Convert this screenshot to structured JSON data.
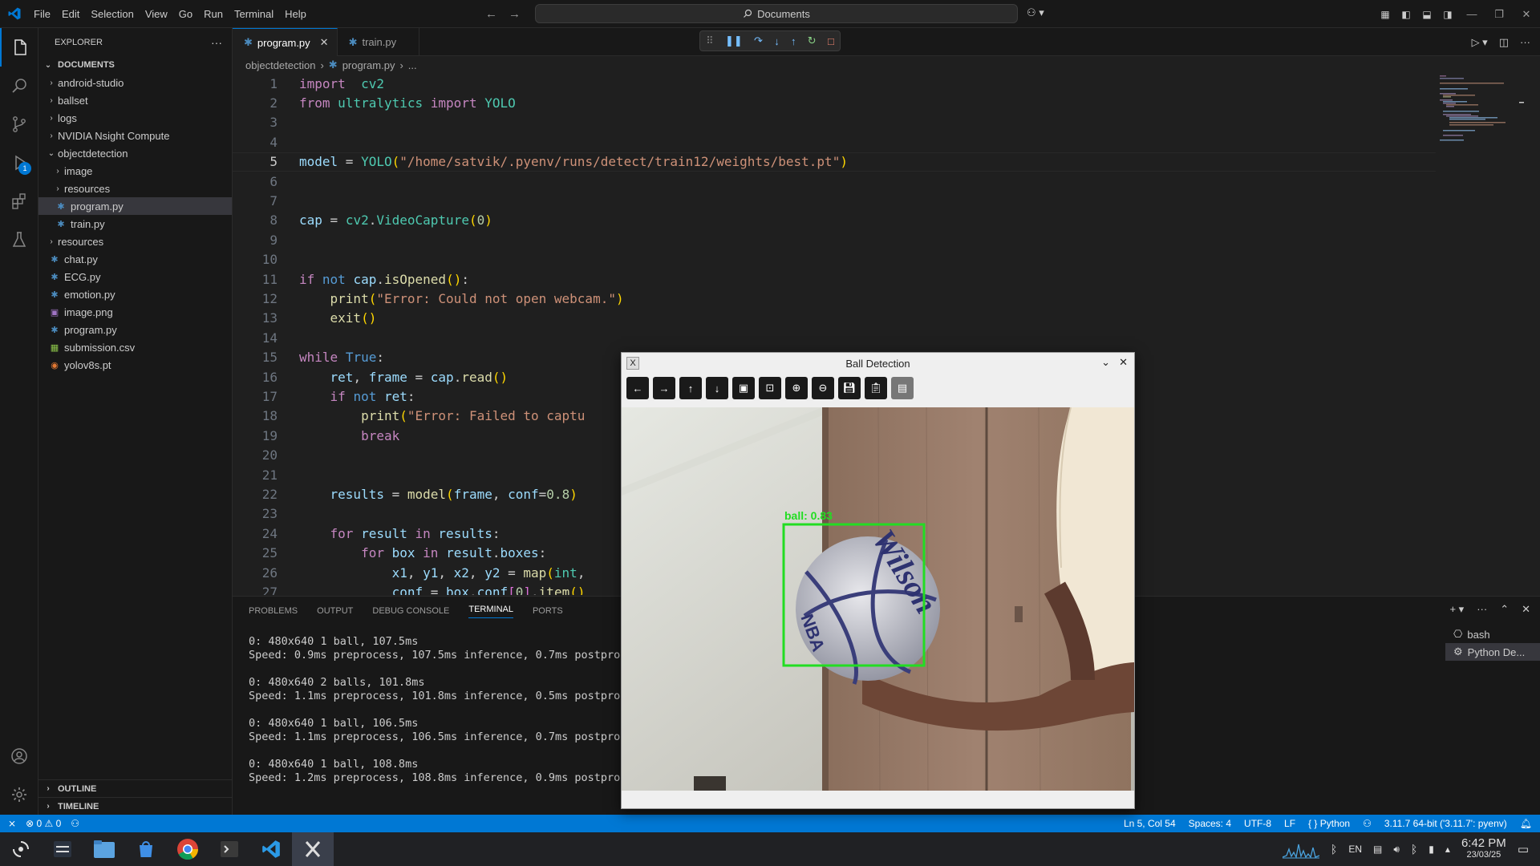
{
  "window": {
    "menu": [
      "File",
      "Edit",
      "Selection",
      "View",
      "Go",
      "Run",
      "Terminal",
      "Help"
    ],
    "search_text": "Documents"
  },
  "sidebar": {
    "header": "EXPLORER",
    "section": "DOCUMENTS",
    "items": [
      {
        "label": "android-studio",
        "type": "folder",
        "depth": 0,
        "open": false
      },
      {
        "label": "ballset",
        "type": "folder",
        "depth": 0,
        "open": false
      },
      {
        "label": "logs",
        "type": "folder",
        "depth": 0,
        "open": false
      },
      {
        "label": "NVIDIA Nsight Compute",
        "type": "folder",
        "depth": 0,
        "open": false
      },
      {
        "label": "objectdetection",
        "type": "folder",
        "depth": 0,
        "open": true
      },
      {
        "label": "image",
        "type": "folder",
        "depth": 1,
        "open": false
      },
      {
        "label": "resources",
        "type": "folder",
        "depth": 1,
        "open": false
      },
      {
        "label": "program.py",
        "type": "py",
        "depth": 1,
        "selected": true
      },
      {
        "label": "train.py",
        "type": "py",
        "depth": 1
      },
      {
        "label": "resources",
        "type": "folder",
        "depth": 0,
        "open": false
      },
      {
        "label": "chat.py",
        "type": "py",
        "depth": 0
      },
      {
        "label": "ECG.py",
        "type": "py",
        "depth": 0
      },
      {
        "label": "emotion.py",
        "type": "py",
        "depth": 0
      },
      {
        "label": "image.png",
        "type": "png",
        "depth": 0
      },
      {
        "label": "program.py",
        "type": "py",
        "depth": 0
      },
      {
        "label": "submission.csv",
        "type": "csv",
        "depth": 0
      },
      {
        "label": "yolov8s.pt",
        "type": "pt",
        "depth": 0
      }
    ],
    "outline": "OUTLINE",
    "timeline": "TIMELINE",
    "debug_badge": "1"
  },
  "tabs": [
    {
      "label": "program.py",
      "active": true
    },
    {
      "label": "train.py",
      "active": false
    }
  ],
  "breadcrumb": [
    "objectdetection",
    "program.py",
    "..."
  ],
  "editor": {
    "current_line": 5,
    "lines": [
      [
        [
          "kw",
          "import"
        ],
        [
          "",
          "  "
        ],
        [
          "cls",
          "cv2"
        ]
      ],
      [
        [
          "kw",
          "from"
        ],
        [
          "",
          " "
        ],
        [
          "cls",
          "ultralytics"
        ],
        [
          "",
          " "
        ],
        [
          "kw",
          "import"
        ],
        [
          "",
          " "
        ],
        [
          "cls",
          "YOLO"
        ]
      ],
      [],
      [],
      [
        [
          "var",
          "model"
        ],
        [
          "",
          " = "
        ],
        [
          "cls",
          "YOLO"
        ],
        [
          "br1",
          "("
        ],
        [
          "str",
          "\"/home/satvik/.pyenv/runs/detect/train12/weights/best.pt\""
        ],
        [
          "br1",
          ")"
        ]
      ],
      [],
      [],
      [
        [
          "var",
          "cap"
        ],
        [
          "",
          " = "
        ],
        [
          "cls",
          "cv2"
        ],
        [
          "",
          "."
        ],
        [
          "cls",
          "VideoCapture"
        ],
        [
          "br1",
          "("
        ],
        [
          "num",
          "0"
        ],
        [
          "br1",
          ")"
        ]
      ],
      [],
      [],
      [
        [
          "kw",
          "if"
        ],
        [
          "",
          " "
        ],
        [
          "kw2",
          "not"
        ],
        [
          "",
          " "
        ],
        [
          "var",
          "cap"
        ],
        [
          "",
          "."
        ],
        [
          "fn",
          "isOpened"
        ],
        [
          "br1",
          "()"
        ],
        [
          "",
          ":"
        ]
      ],
      [
        [
          "",
          "    "
        ],
        [
          "fn",
          "print"
        ],
        [
          "br1",
          "("
        ],
        [
          "str",
          "\"Error: Could not open webcam.\""
        ],
        [
          "br1",
          ")"
        ]
      ],
      [
        [
          "",
          "    "
        ],
        [
          "fn",
          "exit"
        ],
        [
          "br1",
          "()"
        ]
      ],
      [],
      [
        [
          "kw",
          "while"
        ],
        [
          "",
          " "
        ],
        [
          "kw2",
          "True"
        ],
        [
          "",
          ":"
        ]
      ],
      [
        [
          "",
          "    "
        ],
        [
          "var",
          "ret"
        ],
        [
          "",
          ", "
        ],
        [
          "var",
          "frame"
        ],
        [
          "",
          " = "
        ],
        [
          "var",
          "cap"
        ],
        [
          "",
          "."
        ],
        [
          "fn",
          "read"
        ],
        [
          "br1",
          "()"
        ]
      ],
      [
        [
          "",
          "    "
        ],
        [
          "kw",
          "if"
        ],
        [
          "",
          " "
        ],
        [
          "kw2",
          "not"
        ],
        [
          "",
          " "
        ],
        [
          "var",
          "ret"
        ],
        [
          "",
          ":"
        ]
      ],
      [
        [
          "",
          "        "
        ],
        [
          "fn",
          "print"
        ],
        [
          "br1",
          "("
        ],
        [
          "str",
          "\"Error: Failed to captu"
        ]
      ],
      [
        [
          "",
          "        "
        ],
        [
          "kw",
          "break"
        ]
      ],
      [],
      [],
      [
        [
          "",
          "    "
        ],
        [
          "var",
          "results"
        ],
        [
          "",
          " = "
        ],
        [
          "fn",
          "model"
        ],
        [
          "br1",
          "("
        ],
        [
          "var",
          "frame"
        ],
        [
          "",
          ", "
        ],
        [
          "var",
          "conf"
        ],
        [
          "",
          "="
        ],
        [
          "num",
          "0.8"
        ],
        [
          "br1",
          ")"
        ]
      ],
      [],
      [
        [
          "",
          "    "
        ],
        [
          "kw",
          "for"
        ],
        [
          "",
          " "
        ],
        [
          "var",
          "result"
        ],
        [
          "",
          " "
        ],
        [
          "kw",
          "in"
        ],
        [
          "",
          " "
        ],
        [
          "var",
          "results"
        ],
        [
          "",
          ":"
        ]
      ],
      [
        [
          "",
          "        "
        ],
        [
          "kw",
          "for"
        ],
        [
          "",
          " "
        ],
        [
          "var",
          "box"
        ],
        [
          "",
          " "
        ],
        [
          "kw",
          "in"
        ],
        [
          "",
          " "
        ],
        [
          "var",
          "result"
        ],
        [
          "",
          "."
        ],
        [
          "var",
          "boxes"
        ],
        [
          "",
          ":"
        ]
      ],
      [
        [
          "",
          "            "
        ],
        [
          "var",
          "x1"
        ],
        [
          "",
          ", "
        ],
        [
          "var",
          "y1"
        ],
        [
          "",
          ", "
        ],
        [
          "var",
          "x2"
        ],
        [
          "",
          ", "
        ],
        [
          "var",
          "y2"
        ],
        [
          "",
          " = "
        ],
        [
          "fn",
          "map"
        ],
        [
          "br1",
          "("
        ],
        [
          "cls",
          "int"
        ],
        [
          "",
          ","
        ]
      ],
      [
        [
          "",
          "            "
        ],
        [
          "var",
          "conf"
        ],
        [
          "",
          " = "
        ],
        [
          "var",
          "box"
        ],
        [
          "",
          "."
        ],
        [
          "var",
          "conf"
        ],
        [
          "br2",
          "["
        ],
        [
          "num",
          "0"
        ],
        [
          "br2",
          "]"
        ],
        [
          "",
          "."
        ],
        [
          "fn",
          "item"
        ],
        [
          "br1",
          "()"
        ]
      ]
    ]
  },
  "panel": {
    "tabs": [
      "PROBLEMS",
      "OUTPUT",
      "DEBUG CONSOLE",
      "TERMINAL",
      "PORTS"
    ],
    "active_tab": "TERMINAL",
    "terminal_lines": [
      "0: 480x640 1 ball, 107.5ms",
      "Speed: 0.9ms preprocess, 107.5ms inference, 0.7ms postproc",
      "",
      "0: 480x640 2 balls, 101.8ms",
      "Speed: 1.1ms preprocess, 101.8ms inference, 0.5ms postproc",
      "",
      "0: 480x640 1 ball, 106.5ms",
      "Speed: 1.1ms preprocess, 106.5ms inference, 0.7ms postproc",
      "",
      "0: 480x640 1 ball, 108.8ms",
      "Speed: 1.2ms preprocess, 108.8ms inference, 0.9ms postproc"
    ],
    "terminals": [
      "bash",
      "Python De..."
    ]
  },
  "statusbar": {
    "errors": "0",
    "warnings": "0",
    "position": "Ln 5, Col 54",
    "spaces": "Spaces: 4",
    "encoding": "UTF-8",
    "eol": "LF",
    "language": "Python",
    "interpreter": "3.11.7 64-bit ('3.11.7': pyenv)"
  },
  "ball_window": {
    "title": "Ball Detection",
    "detection_label": "ball: 0.83",
    "ball_text_1": "Wilson",
    "ball_text_2": "NBA"
  },
  "taskbar": {
    "lang": "EN",
    "time": "6:42 PM",
    "date": "23/03/25"
  },
  "colors": {
    "accent": "#0078d4",
    "detection_box": "#22dd22",
    "editor_bg": "#1f1f1f"
  }
}
